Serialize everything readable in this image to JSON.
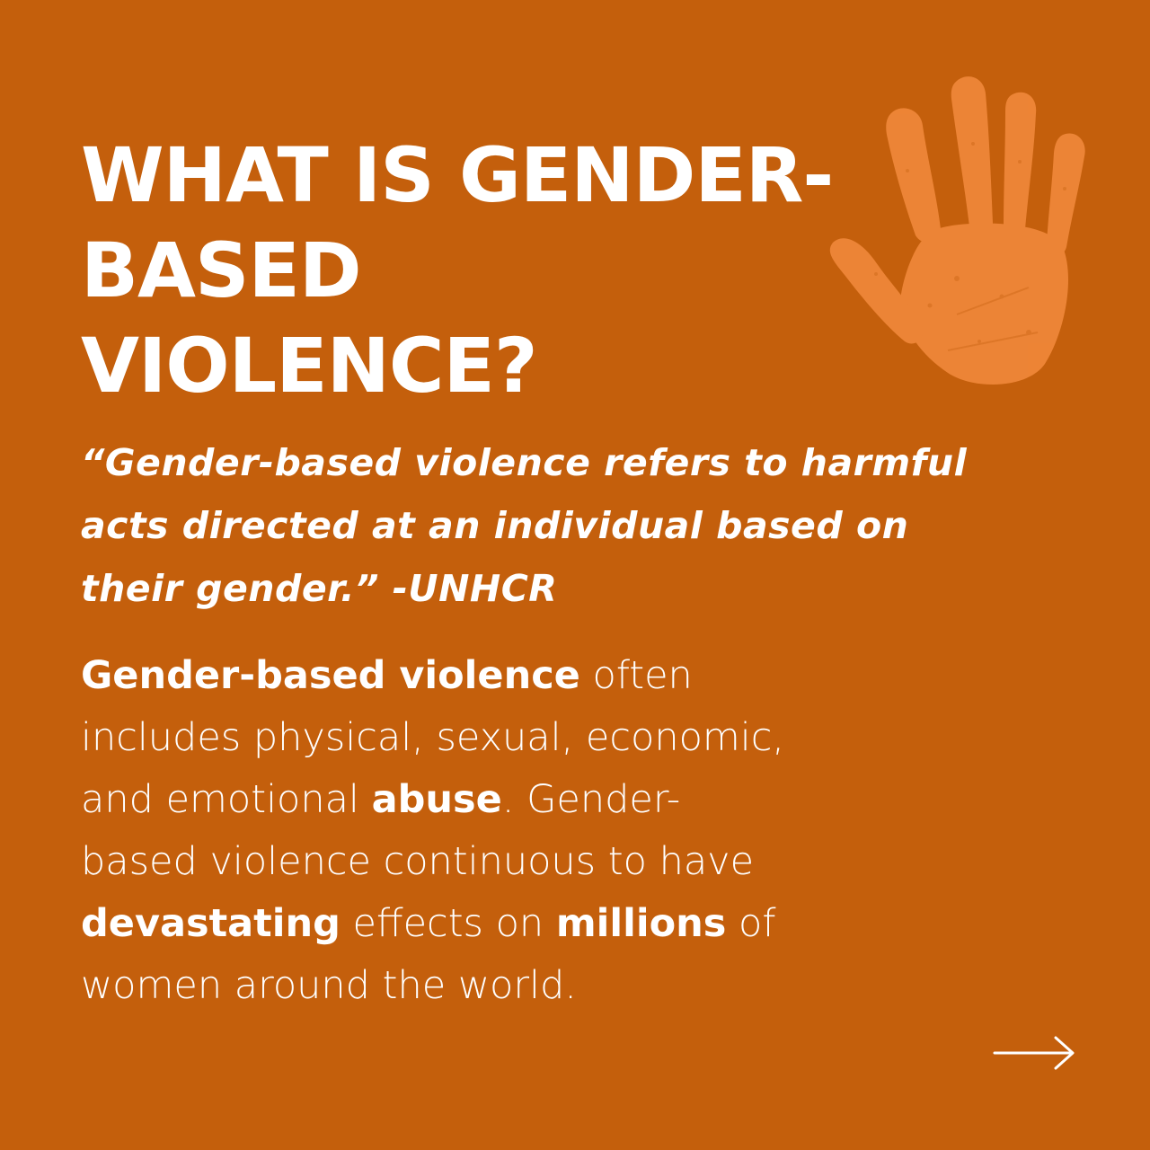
{
  "colors": {
    "background": "#c45f0c",
    "text": "#ffffff",
    "handprint": "#f0883a"
  },
  "decoration": {
    "icon": "handprint-icon"
  },
  "title": {
    "line1": "WHAT IS GENDER-",
    "line2": "BASED",
    "line3": "VIOLENCE?"
  },
  "quote": {
    "line1": "“Gender-based violence refers to harmful",
    "line2": "acts directed at an individual based on",
    "line3": "their gender.” -UNHCR"
  },
  "body": {
    "l1_bold": "Gender-based violence",
    "l1_rest": " often",
    "l2": "includes physical, sexual, economic,",
    "l3_start": "and emotional ",
    "l3_bold": "abuse",
    "l3_rest": ". Gender-",
    "l4": "based violence continuous to have",
    "l5_bold1": "devastating",
    "l5_mid": " effects on ",
    "l5_bold2": "millions",
    "l5_end": " of",
    "l6": "women around the world."
  },
  "navigation": {
    "next_icon": "right-arrow-icon"
  }
}
